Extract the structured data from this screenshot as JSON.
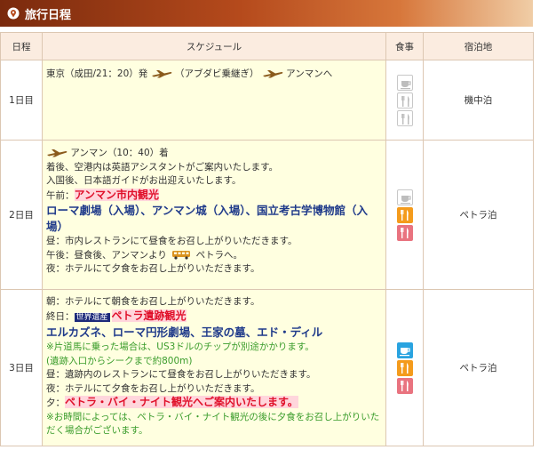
{
  "header": {
    "title": "旅行日程"
  },
  "table": {
    "headers": {
      "day": "日程",
      "schedule": "スケジュール",
      "meal": "食事",
      "hotel": "宿泊地"
    },
    "rows": [
      {
        "day": "1日目",
        "line1": {
          "a": "東京（成田/21：20）発",
          "b": "（アブダビ乗継ぎ）",
          "c": "アンマンへ"
        },
        "meals": {
          "breakfast": false,
          "lunch": false,
          "dinner": false
        },
        "hotel": "機中泊"
      },
      {
        "day": "2日目",
        "arrival": "アンマン（10：40）着",
        "l2": "着後、空港内は英語アシスタントがご案内いたします。",
        "l3": "入国後、日本語ガイドがお出迎えいたします。",
        "am_label": "午前：",
        "am_highlight": "アンマン市内観光",
        "sites": "ローマ劇場（入場）、アンマン城（入場）、国立考古学博物館（入場）",
        "lunch": "昼：市内レストランにて昼食をお召し上がりいただきます。",
        "pm_a": "午後：昼食後、アンマンより",
        "pm_b": "ペトラへ。",
        "dinner": "夜：ホテルにて夕食をお召し上がりいただきます。",
        "meals": {
          "breakfast": false,
          "lunch": true,
          "dinner": true
        },
        "hotel": "ペトラ泊"
      },
      {
        "day": "3日目",
        "breakfast": "朝：ホテルにて朝食をお召し上がりいただきます。",
        "allday_label": "終日：",
        "badge": "世界遺産",
        "allday_highlight": "ペトラ遺跡観光",
        "sites": "エルカズネ、ローマ円形劇場、王家の墓、エド・ディル",
        "note1": "※片道馬に乗った場合は、US3ドルのチップが別途かかります。",
        "note2": "(遺跡入口からシークまで約800m)",
        "lunch": "昼：遺跡内のレストランにて昼食をお召し上がりいただきます。",
        "dinner": "夜：ホテルにて夕食をお召し上がりいただきます。",
        "eve_label": "夕：",
        "eve_highlight": "ペトラ・バイ・ナイト観光へご案内いたします。",
        "note3": "※お時間によっては、ペトラ・バイ・ナイト観光の後に夕食をお召し上がりいただく場合がございます。",
        "meals": {
          "breakfast": true,
          "lunch": true,
          "dinner": true
        },
        "hotel": "ペトラ泊"
      }
    ]
  },
  "icons": {
    "header": "map-pin-icon",
    "plane": "airplane-icon",
    "bus": "bus-icon",
    "breakfast": "coffee-cup-icon",
    "lunch": "fork-knife-icon",
    "dinner": "fork-knife-icon"
  },
  "colors": {
    "header_start": "#7a2a0d",
    "header_end": "#f0cda6",
    "schedule_bg": "#ffffe0",
    "link_blue": "#1f3a8a",
    "highlight_red": "#e0102a",
    "note_green": "#3a9c2b",
    "breakfast": "#29a3e0",
    "lunch": "#f49b1c",
    "dinner": "#e9737f"
  }
}
